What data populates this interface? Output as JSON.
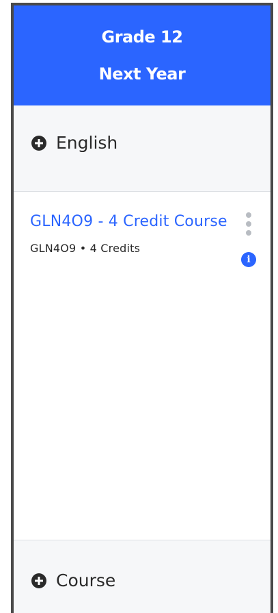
{
  "header": {
    "grade": "Grade 12",
    "period": "Next Year"
  },
  "subject": {
    "label": "English",
    "icon": "plus-circle-icon"
  },
  "course": {
    "title": "GLN4O9 - 4 Credit Course",
    "subtitle": "GLN4O9 • 4 Credits",
    "menu_icon": "kebab-menu-icon",
    "info_icon": "info-icon",
    "info_glyph": "i"
  },
  "add_course": {
    "label": "Course",
    "icon": "plus-circle-icon"
  },
  "colors": {
    "accent": "#2b65ff",
    "panel": "#f6f7f9",
    "text": "#2a2a2a",
    "muted": "#b8bcc2"
  }
}
